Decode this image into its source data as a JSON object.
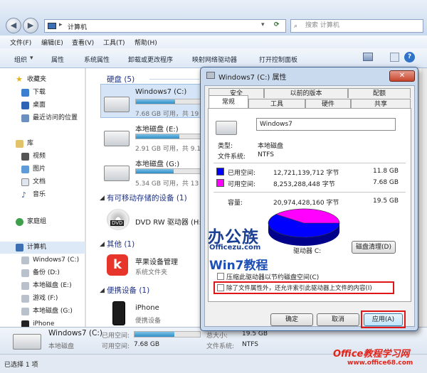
{
  "address": {
    "breadcrumb": "计算机",
    "search_placeholder": "搜索 计算机"
  },
  "menubar": [
    "文件(F)",
    "编辑(E)",
    "查看(V)",
    "工具(T)",
    "帮助(H)"
  ],
  "toolbar": {
    "organize": "组织",
    "properties": "属性",
    "system_properties": "系统属性",
    "uninstall": "卸载或更改程序",
    "map_drive": "映射网络驱动器",
    "control_panel": "打开控制面板"
  },
  "nav": {
    "favorites": "收藏夹",
    "downloads": "下载",
    "desktop": "桌面",
    "recent": "最近访问的位置",
    "libraries": "库",
    "videos": "视频",
    "pictures": "图片",
    "documents": "文档",
    "music": "音乐",
    "homegroup": "家庭组",
    "computer": "计算机",
    "drives": [
      "Windows7 (C:)",
      "备份 (D:)",
      "本地磁盘 (E:)",
      "游戏 (F:)",
      "本地磁盘 (G:)",
      "iPhone"
    ]
  },
  "groups": {
    "hard_disks": "硬盘 (5)",
    "removable": "有可移动存储的设备 (1)",
    "other": "其他 (1)",
    "portable": "便携设备 (1)"
  },
  "drives": [
    {
      "name": "Windows7 (C:)",
      "free": "7.68 GB 可用，共 19",
      "used_fraction": 0.61
    },
    {
      "name": "本地磁盘 (E:)",
      "free": "2.91 GB 可用，共 9.1",
      "used_fraction": 0.68
    },
    {
      "name": "本地磁盘 (G:)",
      "free": "5.34 GB 可用，共 13",
      "used_fraction": 0.59
    }
  ],
  "dvd": {
    "name": "DVD RW 驱动器 (H:)",
    "icon_label": "DVD"
  },
  "other": {
    "name": "苹果设备管理",
    "desc": "系统文件夹"
  },
  "portable": {
    "name": "iPhone",
    "desc": "便携设备"
  },
  "details": {
    "name": "Windows7 (C:)",
    "type": "本地磁盘",
    "used_label": "已用空间:",
    "free_label": "可用空间:",
    "free": "7.68 GB",
    "total_label": "总大小:",
    "total": "19.5 GB",
    "fs_label": "文件系统:",
    "fs": "NTFS",
    "used_fraction": 0.61
  },
  "status": {
    "selected": "已选择 1 项"
  },
  "dialog": {
    "title": "Windows7 (C:) 属性",
    "tabs_row1": [
      "安全",
      "以前的版本",
      "配额"
    ],
    "tabs_row2": [
      "常规",
      "工具",
      "硬件",
      "共享"
    ],
    "volume_name": "Windows7",
    "type_label": "类型:",
    "type_value": "本地磁盘",
    "fs_label": "文件系统:",
    "fs_value": "NTFS",
    "used_label": "已用空间:",
    "used_bytes": "12,721,139,712 字节",
    "used_gb": "11.8 GB",
    "free_label": "可用空间:",
    "free_bytes": "8,253,288,448 字节",
    "free_gb": "7.68 GB",
    "capacity_label": "容量:",
    "capacity_bytes": "20,974,428,160 字节",
    "capacity_gb": "19.5 GB",
    "drive_label": "驱动器 C:",
    "cleanup_button": "磁盘清理(D)",
    "compress_label": "压缩此驱动器以节约磁盘空间(C)",
    "index_label": "除了文件属性外，还允许索引此驱动器上文件的内容(I)",
    "ok_button": "确定",
    "cancel_button": "取消",
    "apply_button": "应用(A)",
    "used_fraction": 0.6065,
    "colors": {
      "used": "#0000ff",
      "free": "#ff00ff"
    }
  },
  "watermarks": {
    "logo1": "办公族",
    "logo1_sub": "Officezu.com",
    "logo2": "Win7教程",
    "logo3": "Office教程学习网",
    "logo3_sub": "www.office68.com"
  }
}
